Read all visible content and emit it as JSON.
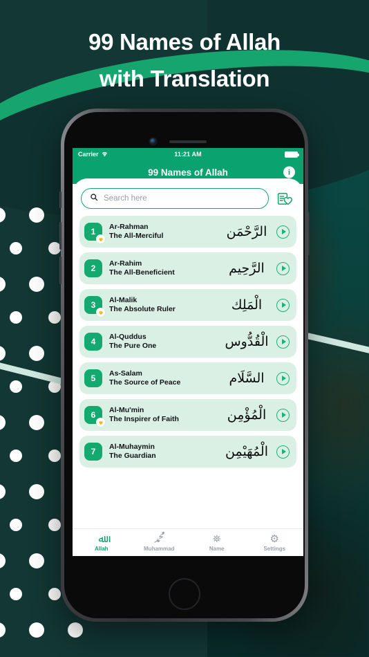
{
  "promo": {
    "headline_line1": "99 Names of Allah",
    "headline_line2": "with Translation",
    "accent_color": "#16a46f",
    "bg_color": "#123734"
  },
  "status_bar": {
    "carrier": "Carrier",
    "wifi_icon": "wifi-icon",
    "time": "11:21 AM",
    "battery_icon": "battery-full-icon"
  },
  "app_bar": {
    "title": "99 Names of Allah",
    "info_label": "i",
    "info_icon": "info-icon",
    "color": "#0aa26e"
  },
  "search": {
    "placeholder": "Search here",
    "value": "",
    "search_icon": "search-icon",
    "favorites_icon": "favorites-list-heart-icon"
  },
  "names": [
    {
      "number": "1",
      "transliteration": "Ar-Rahman",
      "meaning": "The All-Merciful",
      "arabic": "الرَّحْمَن",
      "favorite": true,
      "play_icon": "play-icon"
    },
    {
      "number": "2",
      "transliteration": "Ar-Rahim",
      "meaning": "The All-Beneficient",
      "arabic": "الرَّحِيم",
      "favorite": false,
      "play_icon": "play-icon"
    },
    {
      "number": "3",
      "transliteration": "Al-Malik",
      "meaning": "The Absolute Ruler",
      "arabic": "الْمَلِك",
      "favorite": true,
      "play_icon": "play-icon"
    },
    {
      "number": "4",
      "transliteration": "Al-Quddus",
      "meaning": "The Pure One",
      "arabic": "الْقُدُّوس",
      "favorite": false,
      "play_icon": "play-icon"
    },
    {
      "number": "5",
      "transliteration": "As-Salam",
      "meaning": "The Source of Peace",
      "arabic": "السَّلَام",
      "favorite": false,
      "play_icon": "play-icon"
    },
    {
      "number": "6",
      "transliteration": "Al-Mu'min",
      "meaning": "The Inspirer of Faith",
      "arabic": "الْمُؤْمِن",
      "favorite": true,
      "play_icon": "play-icon"
    },
    {
      "number": "7",
      "transliteration": "Al-Muhaymin",
      "meaning": "The Guardian",
      "arabic": "الْمُهَيْمِن",
      "favorite": false,
      "play_icon": "play-icon"
    }
  ],
  "tabs": [
    {
      "label": "Allah",
      "glyph": "ﷲ",
      "icon": "allah-calligraphy-icon",
      "active": true
    },
    {
      "label": "Muhammad",
      "glyph": "ﷴ",
      "icon": "muhammad-calligraphy-icon",
      "active": false
    },
    {
      "label": "Name",
      "glyph": "⛯",
      "icon": "name-tag-icon",
      "active": false
    },
    {
      "label": "Settings",
      "glyph": "⚙",
      "icon": "gear-icon",
      "active": false
    }
  ]
}
